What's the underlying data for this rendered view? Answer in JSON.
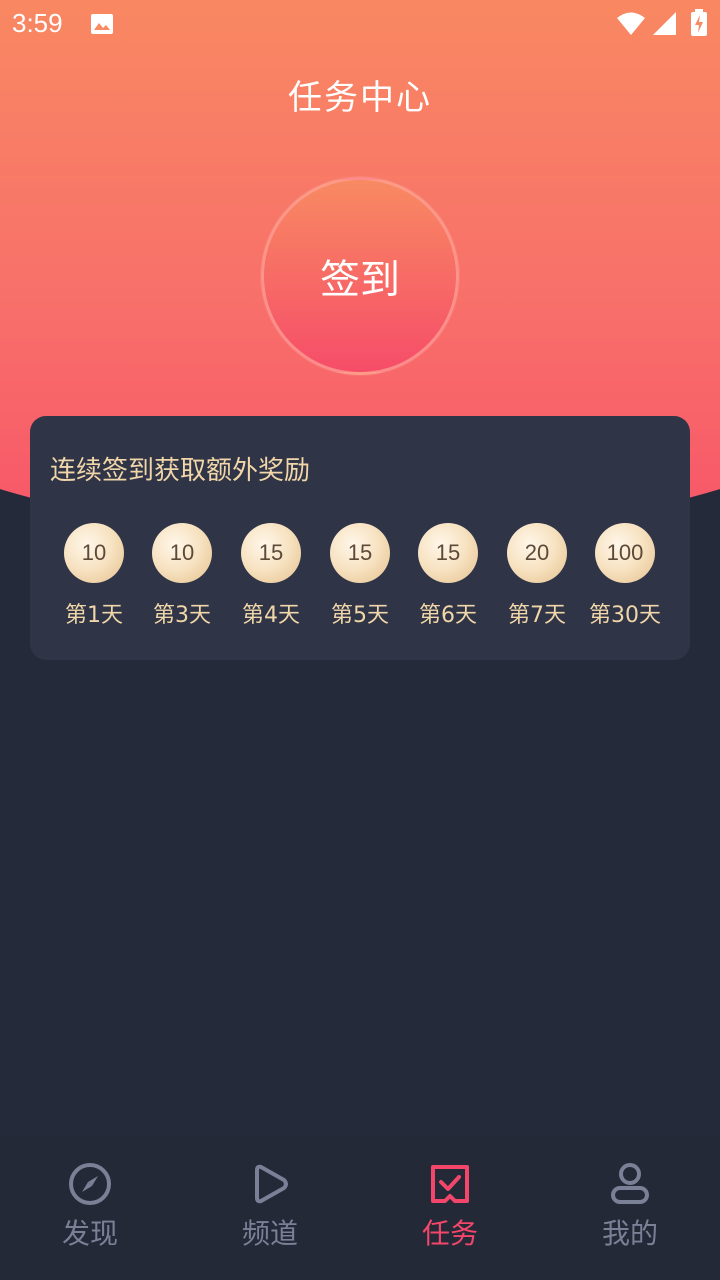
{
  "status_bar": {
    "time": "3:59"
  },
  "header": {
    "title": "任务中心"
  },
  "checkin": {
    "button_label": "签到"
  },
  "rewards": {
    "title": "连续签到获取额外奖励",
    "items": [
      {
        "points": "10",
        "day": "第1天"
      },
      {
        "points": "10",
        "day": "第3天"
      },
      {
        "points": "15",
        "day": "第4天"
      },
      {
        "points": "15",
        "day": "第5天"
      },
      {
        "points": "15",
        "day": "第6天"
      },
      {
        "points": "20",
        "day": "第7天"
      },
      {
        "points": "100",
        "day": "第30天"
      }
    ]
  },
  "nav": {
    "items": [
      {
        "label": "发现",
        "icon": "compass-icon",
        "active": false
      },
      {
        "label": "频道",
        "icon": "play-icon",
        "active": false
      },
      {
        "label": "任务",
        "icon": "task-check-icon",
        "active": true
      },
      {
        "label": "我的",
        "icon": "user-icon",
        "active": false
      }
    ]
  },
  "colors": {
    "accent": "#f3466a",
    "nav_inactive": "#7a8196",
    "reward_text": "#f0d6a8",
    "background": "#242a39",
    "card": "#2f3447"
  }
}
